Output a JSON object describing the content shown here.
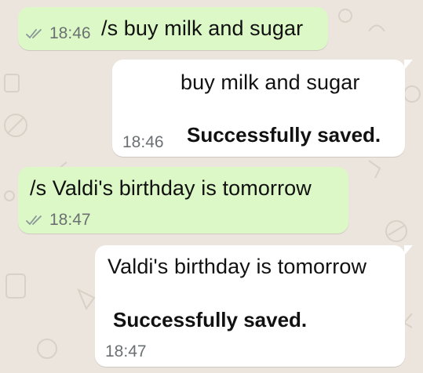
{
  "chat": {
    "messages": [
      {
        "direction": "outgoing",
        "time": "18:46",
        "text": "/s buy milk and sugar",
        "read_icon": "double-check-icon"
      },
      {
        "direction": "incoming",
        "text": "buy milk and sugar",
        "status": "Successfully saved.",
        "time": "18:46"
      },
      {
        "direction": "outgoing",
        "text": "/s Valdi's birthday is tomorrow",
        "time": "18:47",
        "read_icon": "double-check-icon"
      },
      {
        "direction": "incoming",
        "text": "Valdi's birthday is tomorrow",
        "status": "Successfully saved.",
        "time": "18:47"
      }
    ]
  },
  "colors": {
    "background": "#ECE5DD",
    "outgoing_bubble": "#DCF8C6",
    "incoming_bubble": "#FFFFFF",
    "meta_text": "#6B7072",
    "tick": "#8A9599"
  }
}
